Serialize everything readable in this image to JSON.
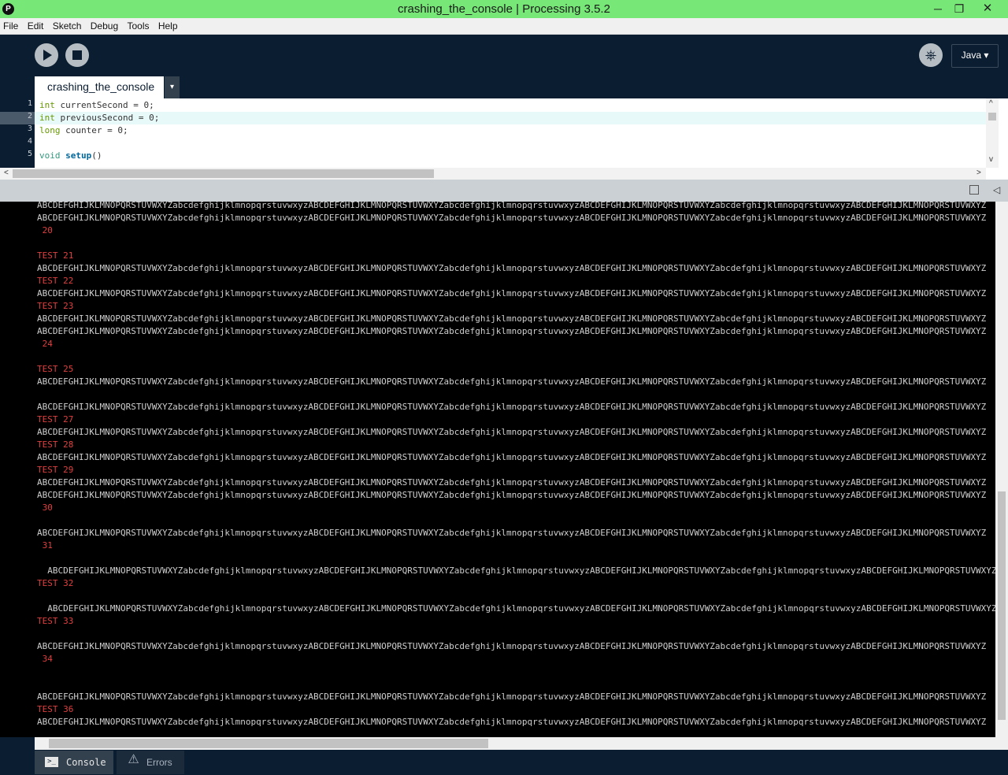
{
  "window": {
    "title": "crashing_the_console | Processing 3.5.2",
    "app_icon": "P",
    "min_icon": "─",
    "max_icon": "❐",
    "close_icon": "✕"
  },
  "menu": [
    "File",
    "Edit",
    "Sketch",
    "Debug",
    "Tools",
    "Help"
  ],
  "toolbar": {
    "mode_label": "Java ▾",
    "debug_icon": "⎈"
  },
  "tab": {
    "name": "crashing_the_console",
    "menu_arrow": "▾"
  },
  "editor": {
    "line_numbers": [
      "1",
      "2",
      "3",
      "4",
      "5"
    ],
    "lines": [
      {
        "type": "int",
        "rest": " currentSecond = 0;"
      },
      {
        "type": "int",
        "rest": " previousSecond = 0;"
      },
      {
        "type": "long",
        "rest": " counter = 0;"
      },
      {
        "type": "",
        "rest": ""
      },
      {
        "type": "void",
        "fn": "setup",
        "rest": "()"
      }
    ],
    "scroll_left": "<",
    "scroll_right": ">",
    "scroll_up": "^",
    "scroll_down": "v"
  },
  "console": {
    "alpha": "ABCDEFGHIJKLMNOPQRSTUVWXYZabcdefghijklmnopqrstuvwxyzABCDEFGHIJKLMNOPQRSTUVWXYZabcdefghijklmnopqrstuvwxyzABCDEFGHIJKLMNOPQRSTUVWXYZabcdefghijklmnopqrstuvwxyzABCDEFGHIJKLMNOPQRSTUVWXYZ",
    "lines": [
      {
        "row": 0,
        "kind": "alpha",
        "text": ""
      },
      {
        "row": 1,
        "kind": "alpha",
        "text": ""
      },
      {
        "row": 2,
        "kind": "red",
        "text": " 20"
      },
      {
        "row": 4,
        "kind": "red",
        "text": "TEST 21"
      },
      {
        "row": 5,
        "kind": "alpha",
        "text": ""
      },
      {
        "row": 6,
        "kind": "red",
        "text": "TEST 22"
      },
      {
        "row": 7,
        "kind": "alpha",
        "text": ""
      },
      {
        "row": 8,
        "kind": "red",
        "text": "TEST 23"
      },
      {
        "row": 9,
        "kind": "alpha",
        "text": ""
      },
      {
        "row": 10,
        "kind": "alpha",
        "text": ""
      },
      {
        "row": 11,
        "kind": "red",
        "text": " 24"
      },
      {
        "row": 13,
        "kind": "red",
        "text": "TEST 25"
      },
      {
        "row": 14,
        "kind": "alpha",
        "text": ""
      },
      {
        "row": 16,
        "kind": "alpha",
        "text": ""
      },
      {
        "row": 17,
        "kind": "red",
        "text": "TEST 27"
      },
      {
        "row": 18,
        "kind": "alpha",
        "text": ""
      },
      {
        "row": 19,
        "kind": "red",
        "text": "TEST 28"
      },
      {
        "row": 20,
        "kind": "alpha",
        "text": ""
      },
      {
        "row": 21,
        "kind": "red",
        "text": "TEST 29"
      },
      {
        "row": 22,
        "kind": "alpha",
        "text": ""
      },
      {
        "row": 23,
        "kind": "alpha",
        "text": ""
      },
      {
        "row": 24,
        "kind": "red",
        "text": " 30"
      },
      {
        "row": 26,
        "kind": "alpha",
        "text": ""
      },
      {
        "row": 27,
        "kind": "red",
        "text": " 31"
      },
      {
        "row": 29,
        "kind": "alpha-indent",
        "text": ""
      },
      {
        "row": 30,
        "kind": "red",
        "text": "TEST 32"
      },
      {
        "row": 32,
        "kind": "alpha-indent",
        "text": ""
      },
      {
        "row": 33,
        "kind": "red",
        "text": "TEST 33"
      },
      {
        "row": 35,
        "kind": "alpha",
        "text": ""
      },
      {
        "row": 36,
        "kind": "red",
        "text": " 34"
      },
      {
        "row": 39,
        "kind": "alpha",
        "text": ""
      },
      {
        "row": 40,
        "kind": "red",
        "text": "TEST 36"
      },
      {
        "row": 41,
        "kind": "alpha",
        "text": ""
      }
    ],
    "collapse_icon": "◁",
    "copy_icon": "▤"
  },
  "footer": {
    "console_label": "Console",
    "errors_label": "Errors",
    "console_icon": ">_",
    "errors_icon": "⚠"
  },
  "colors": {
    "titlebar": "#77e877",
    "ide_bg": "#0b1d31",
    "console_text": "#cfcfcf",
    "console_red": "#e13f3f"
  }
}
